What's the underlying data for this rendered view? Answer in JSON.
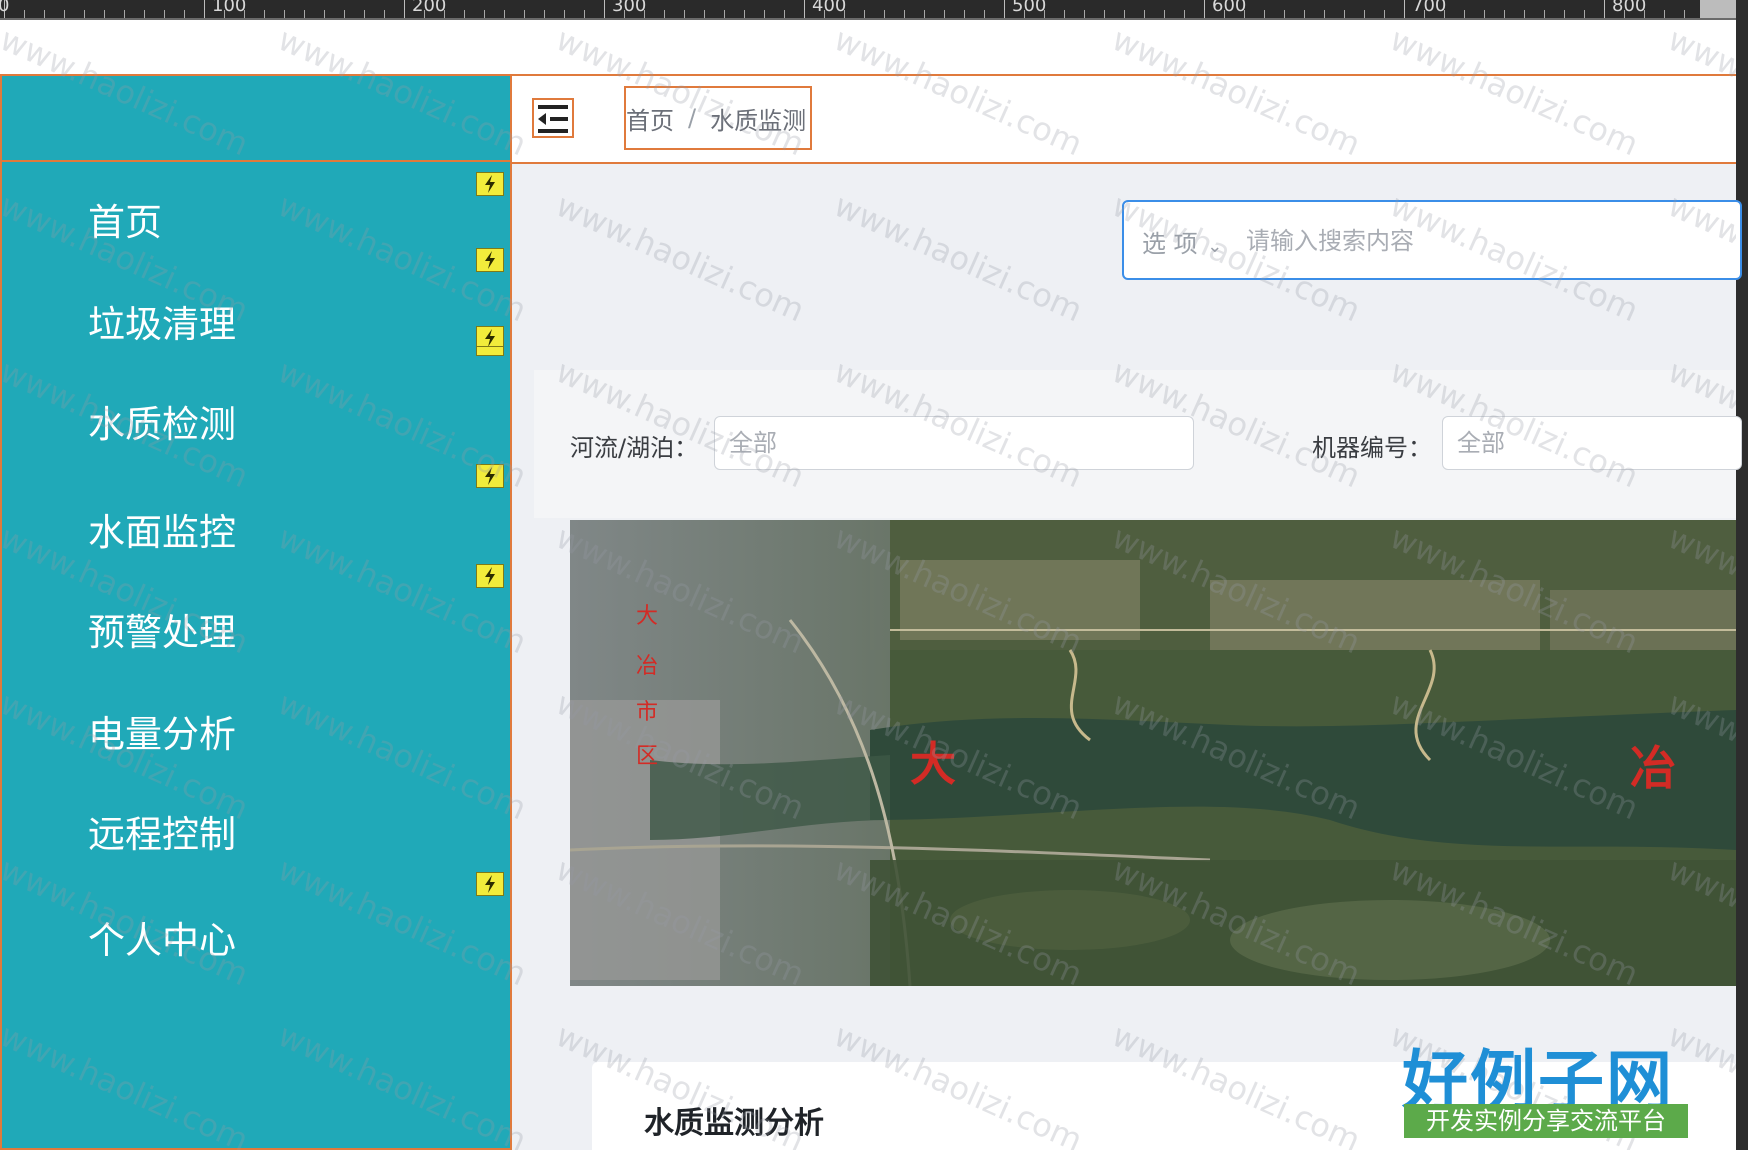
{
  "ruler": {
    "labels": [
      "0",
      "100",
      "200",
      "300",
      "400",
      "500",
      "600",
      "700",
      "800"
    ]
  },
  "sidebar": {
    "items": [
      {
        "label": "首页"
      },
      {
        "label": "垃圾清理"
      },
      {
        "label": "水质检测"
      },
      {
        "label": "水面监控"
      },
      {
        "label": "预警处理"
      },
      {
        "label": "电量分析"
      },
      {
        "label": "远程控制"
      },
      {
        "label": "个人中心"
      }
    ]
  },
  "header": {
    "breadcrumb": {
      "home": "首页",
      "separator": "/",
      "current": "水质监测"
    }
  },
  "search": {
    "select_label": "选 项",
    "placeholder": "请输入搜索内容"
  },
  "filters": {
    "river_label": "河流/湖泊：",
    "river_value": "全部",
    "machine_label": "机器编号：",
    "machine_value": "全部"
  },
  "map": {
    "labels": [
      "大",
      "冶",
      "大",
      "冶",
      "市",
      "区"
    ]
  },
  "card": {
    "title": "水质监测分析"
  },
  "watermark": {
    "text": "www.haolizi.com",
    "brand_main": "好例子网",
    "brand_sub": "开发实例分享交流平台"
  },
  "colors": {
    "sidebar_bg": "#20a9b8",
    "highlight_border": "#e07a3c",
    "search_border": "#3b8ee8",
    "bolt_badge": "#f2ec3b",
    "brand_blue": "#1f8fd6",
    "brand_green": "#5caa4a"
  }
}
